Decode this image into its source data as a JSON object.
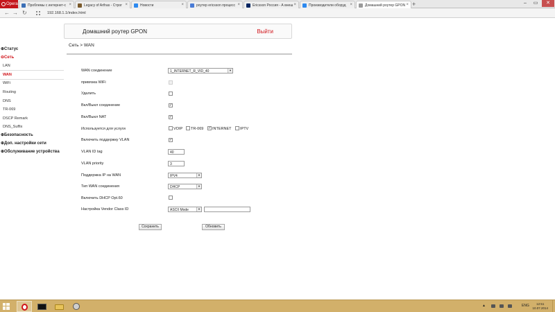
{
  "browser": {
    "app_label": "Opera",
    "tabs": [
      {
        "title": "Проблемы с интернет-с",
        "icon": "speech-icon",
        "color": "#3b6fb6"
      },
      {
        "title": "Legacy of Arthas - Строг",
        "icon": "shield-icon",
        "color": "#7a5a2c"
      },
      {
        "title": "Новости",
        "icon": "windows-icon",
        "color": "#2d89ef"
      },
      {
        "title": "роутер ericsson процесс",
        "icon": "search-icon",
        "color": "#4a7cd6"
      },
      {
        "title": "Ericsson Россия - А внеш",
        "icon": "ericsson-icon",
        "color": "#002561"
      },
      {
        "title": "Производители оборуд",
        "icon": "windows-icon",
        "color": "#2d89ef"
      },
      {
        "title": "Домашний роутер GPON",
        "icon": "page-icon",
        "color": "#9a9a9a"
      }
    ],
    "new_tab_symbol": "+",
    "window_controls": [
      "‒",
      "▭",
      "✕"
    ],
    "url": "192.168.1.1/index.html"
  },
  "header": {
    "title": "Домашний роутер GPON",
    "logout": "Выйти"
  },
  "sidebar": {
    "status": "Статус",
    "network": "Сеть",
    "network_items": [
      "LAN",
      "WAN",
      "WiFi",
      "Routing",
      "DNS",
      "TR-069",
      "DSCP Remark",
      "DNS_Suffix"
    ],
    "security": "Безопасность",
    "advanced": "Доп. настройки сети",
    "maintenance": "Обслуживание устройства"
  },
  "breadcrumb": "Сеть > WAN",
  "form": {
    "wan_connection": {
      "label": "WAN соединение",
      "value": "1_INTERNET_R_VID_40"
    },
    "bridge_wifi": {
      "label": "привязка WiFi",
      "checked": false,
      "disabled": true
    },
    "delete": {
      "label": "Удалить",
      "checked": false
    },
    "enable_connection": {
      "label": "Вкл/Выкл соединение",
      "checked": true
    },
    "enable_nat": {
      "label": "Вкл/Выкл NAT",
      "checked": true
    },
    "services": {
      "label": "Используется для услуги",
      "voip": {
        "label": "VOIP",
        "checked": false
      },
      "tr069": {
        "label": "TR-069",
        "checked": false
      },
      "internet": {
        "label": "INTERNET",
        "checked": true
      },
      "iptv": {
        "label": "IPTV",
        "checked": false
      }
    },
    "enable_vlan": {
      "label": "Включить поддержку VLAN",
      "checked": true
    },
    "vlan_id": {
      "label": "VLAN ID tag",
      "value": "40"
    },
    "vlan_priority": {
      "label": "VLAN priority",
      "value": "3"
    },
    "ip_support": {
      "label": "Поддержка IP на WAN",
      "value": "IPV4"
    },
    "wan_type": {
      "label": "Тип WAN соединения",
      "value": "DHCP"
    },
    "dhcp_opt60": {
      "label": "Включить DHCP Opt.60",
      "checked": false
    },
    "vendor_class": {
      "label": "Настройка Vendor Class ID",
      "mode": "ASCII Mode",
      "value": ""
    },
    "save_button": "Сохранить",
    "refresh_button": "Обновить"
  },
  "taskbar": {
    "language": "ENG",
    "time": "12:51",
    "date": "10.07.2014"
  }
}
